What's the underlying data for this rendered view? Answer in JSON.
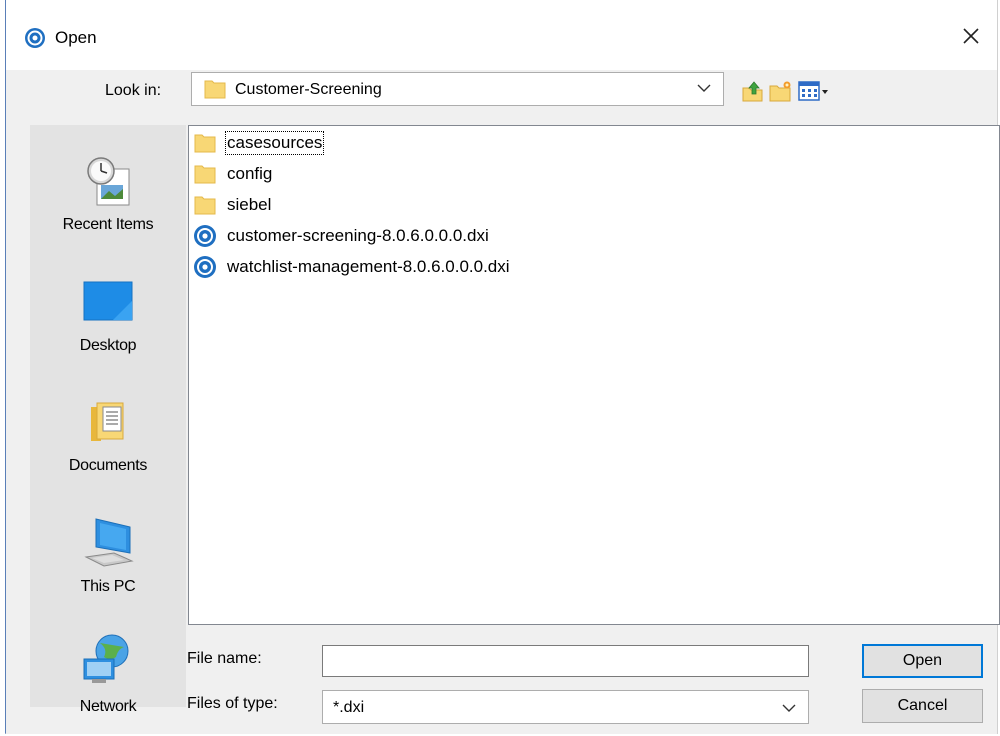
{
  "window": {
    "title": "Open"
  },
  "toolbar": {
    "look_in_label": "Look in:",
    "look_in_value": "Customer-Screening"
  },
  "places": [
    {
      "label": "Recent Items",
      "icon": "recent-items-icon"
    },
    {
      "label": "Desktop",
      "icon": "desktop-icon"
    },
    {
      "label": "Documents",
      "icon": "documents-icon"
    },
    {
      "label": "This PC",
      "icon": "this-pc-icon"
    },
    {
      "label": "Network",
      "icon": "network-icon"
    }
  ],
  "files": [
    {
      "name": "casesources",
      "type": "folder"
    },
    {
      "name": "config",
      "type": "folder"
    },
    {
      "name": "siebel",
      "type": "folder"
    },
    {
      "name": "customer-screening-8.0.6.0.0.0.dxi",
      "type": "dxi"
    },
    {
      "name": "watchlist-management-8.0.6.0.0.0.dxi",
      "type": "dxi"
    }
  ],
  "form": {
    "file_name_label": "File name:",
    "file_name_value": "",
    "files_of_type_label": "Files of type:",
    "files_of_type_value": "*.dxi"
  },
  "buttons": {
    "open": "Open",
    "cancel": "Cancel"
  },
  "colors": {
    "accent": "#0078d7",
    "folder": "#f8d775",
    "app_icon": "#1f6fc1"
  }
}
